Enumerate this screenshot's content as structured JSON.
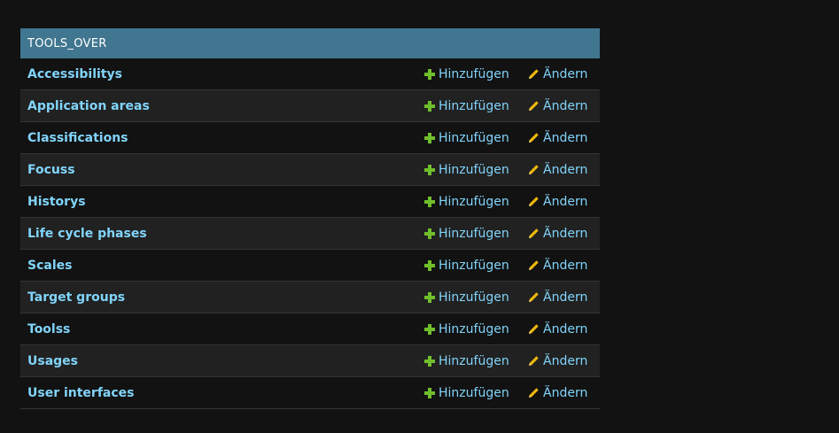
{
  "app_module": {
    "caption": "TOOLS_OVER",
    "add_label": "Hinzufügen",
    "change_label": "Ändern",
    "models": [
      {
        "name": "Accessibilitys"
      },
      {
        "name": "Application areas"
      },
      {
        "name": "Classifications"
      },
      {
        "name": "Focuss"
      },
      {
        "name": "Historys"
      },
      {
        "name": "Life cycle phases"
      },
      {
        "name": "Scales"
      },
      {
        "name": "Target groups"
      },
      {
        "name": "Toolss"
      },
      {
        "name": "Usages"
      },
      {
        "name": "User interfaces"
      }
    ]
  },
  "colors": {
    "caption_bg": "#417690",
    "link": "#81d4fa",
    "add_icon": "#70bf2b",
    "change_icon": "#efb80b",
    "page_bg": "#121212"
  }
}
